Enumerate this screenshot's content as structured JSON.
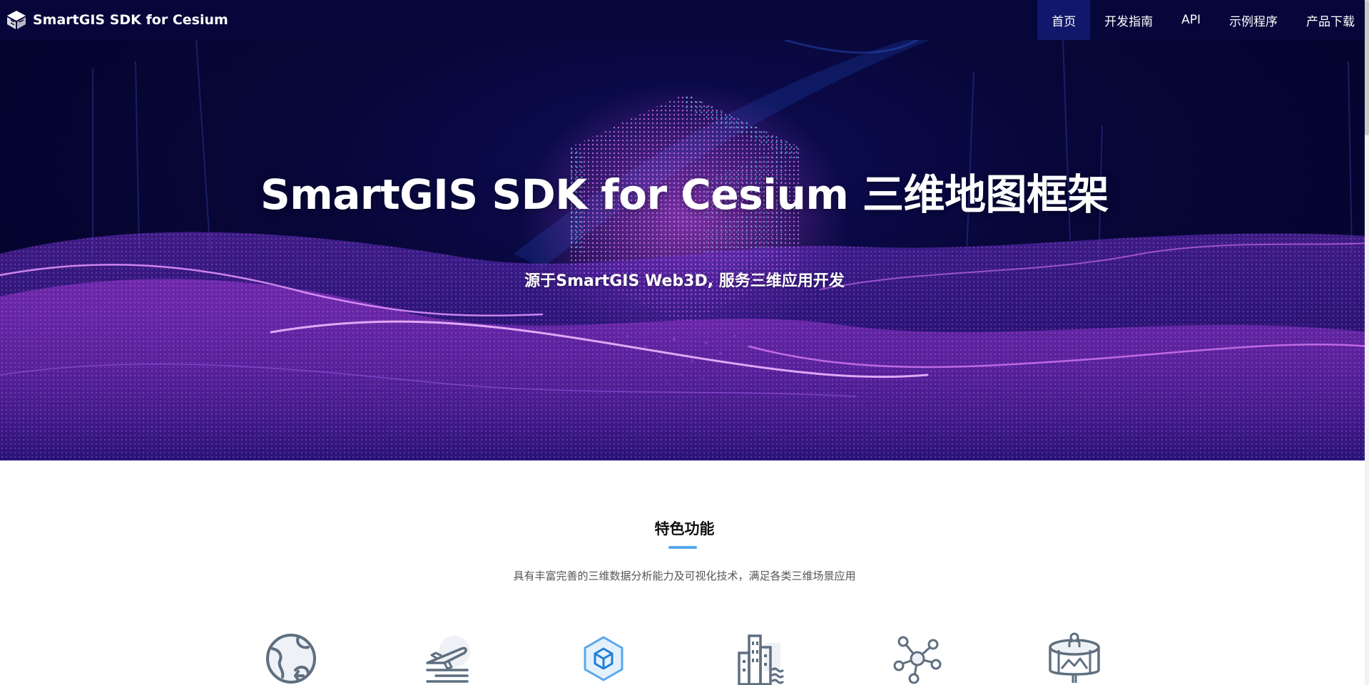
{
  "header": {
    "brand": "SmartGIS SDK for Cesium",
    "nav": [
      {
        "label": "首页",
        "active": true
      },
      {
        "label": "开发指南",
        "active": false
      },
      {
        "label": "API",
        "active": false
      },
      {
        "label": "示例程序",
        "active": false
      },
      {
        "label": "产品下载",
        "active": false
      }
    ]
  },
  "hero": {
    "title": "SmartGIS SDK for Cesium 三维地图框架",
    "subtitle": "源于SmartGIS Web3D, 服务三维应用开发"
  },
  "features": {
    "title": "特色功能",
    "description": "具有丰富完善的三维数据分析能力及可视化技术，满足各类三维场景应用",
    "icons": [
      "globe-icon",
      "airplane-icon",
      "cube-icon",
      "city-icon",
      "network-icon",
      "panorama-icon"
    ]
  },
  "colors": {
    "header_bg": "#06063a",
    "nav_active_bg": "#11176a",
    "accent_blue": "#58a8ec",
    "hero_purple": "#c04ad8",
    "icon_gray": "#5f6f80"
  }
}
